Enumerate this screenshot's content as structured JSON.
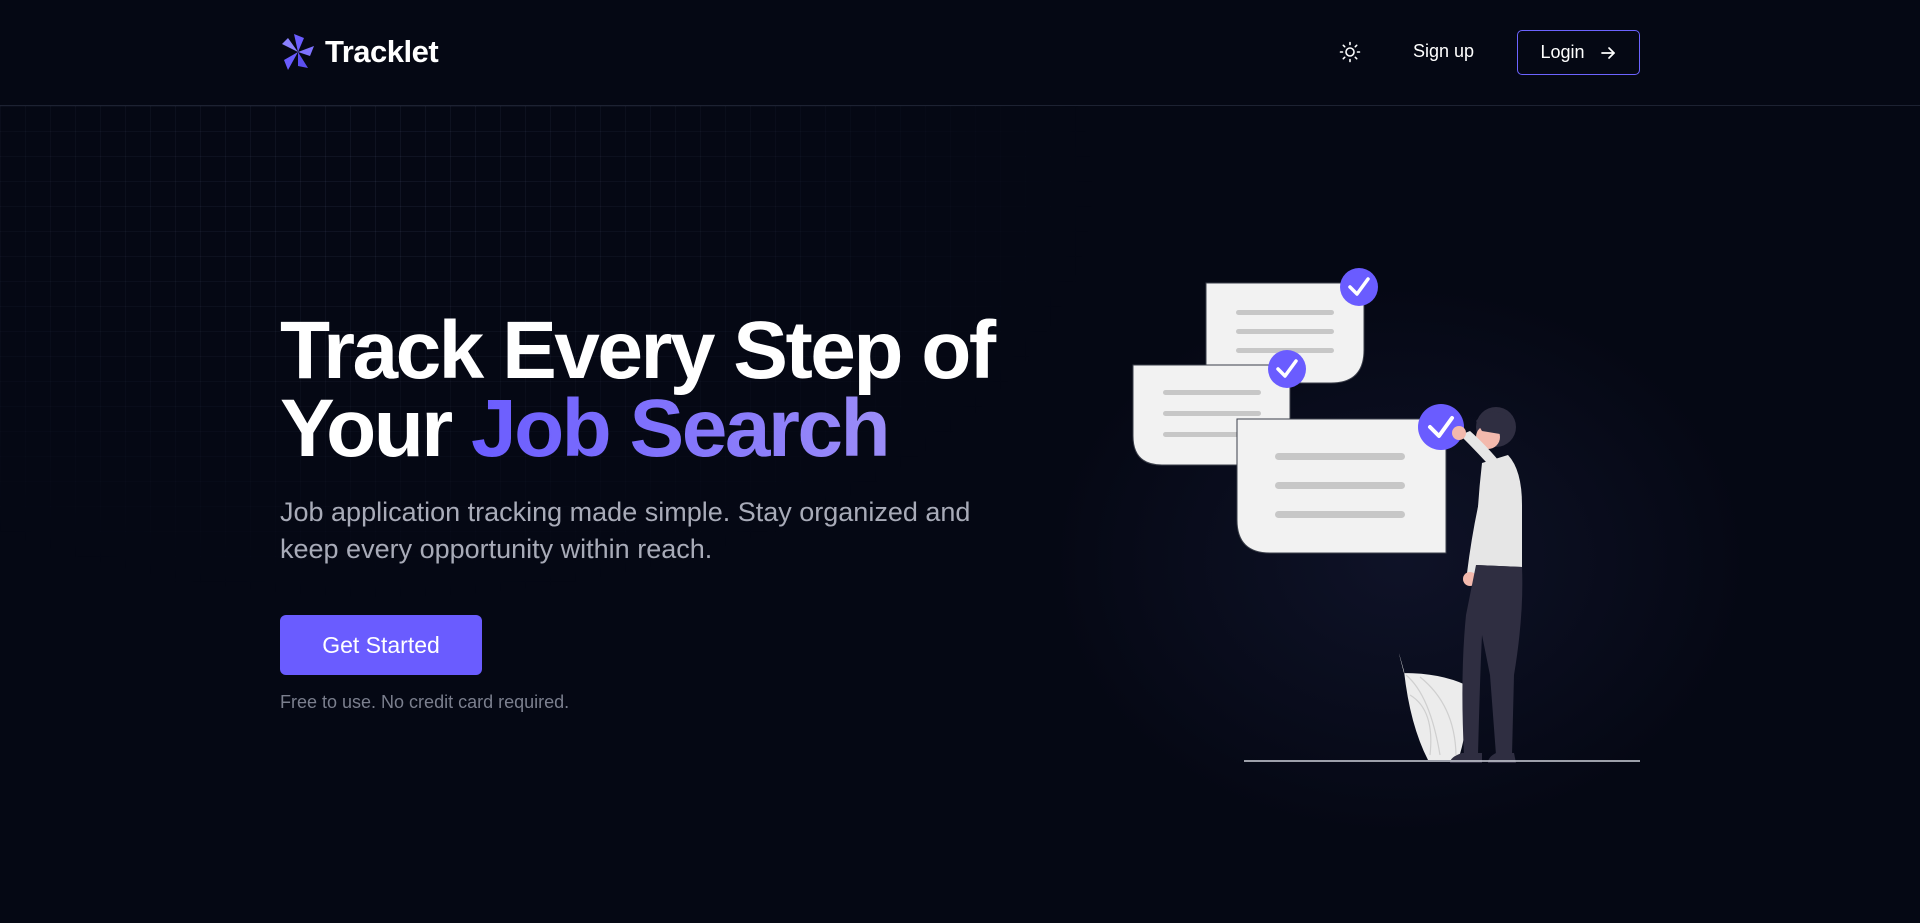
{
  "header": {
    "brand": "Tracklet",
    "signup_label": "Sign up",
    "login_label": "Login"
  },
  "hero": {
    "title_line1": "Track Every Step of",
    "title_line2_plain": "Your ",
    "title_line2_accent": "Job Search",
    "subtitle": "Job application tracking made simple. Stay organized and keep every opportunity within reach.",
    "cta_label": "Get Started",
    "cta_note": "Free to use. No credit card required."
  },
  "icons": {
    "logo": "pinwheel-logo-icon",
    "theme": "sun-icon",
    "login": "arrow-right-icon",
    "check": "check-icon"
  },
  "colors": {
    "background": "#050814",
    "accent": "#6a5cff",
    "accent_light": "#9b8df8",
    "text_muted": "#a8abb8",
    "border": "#1d2232"
  }
}
